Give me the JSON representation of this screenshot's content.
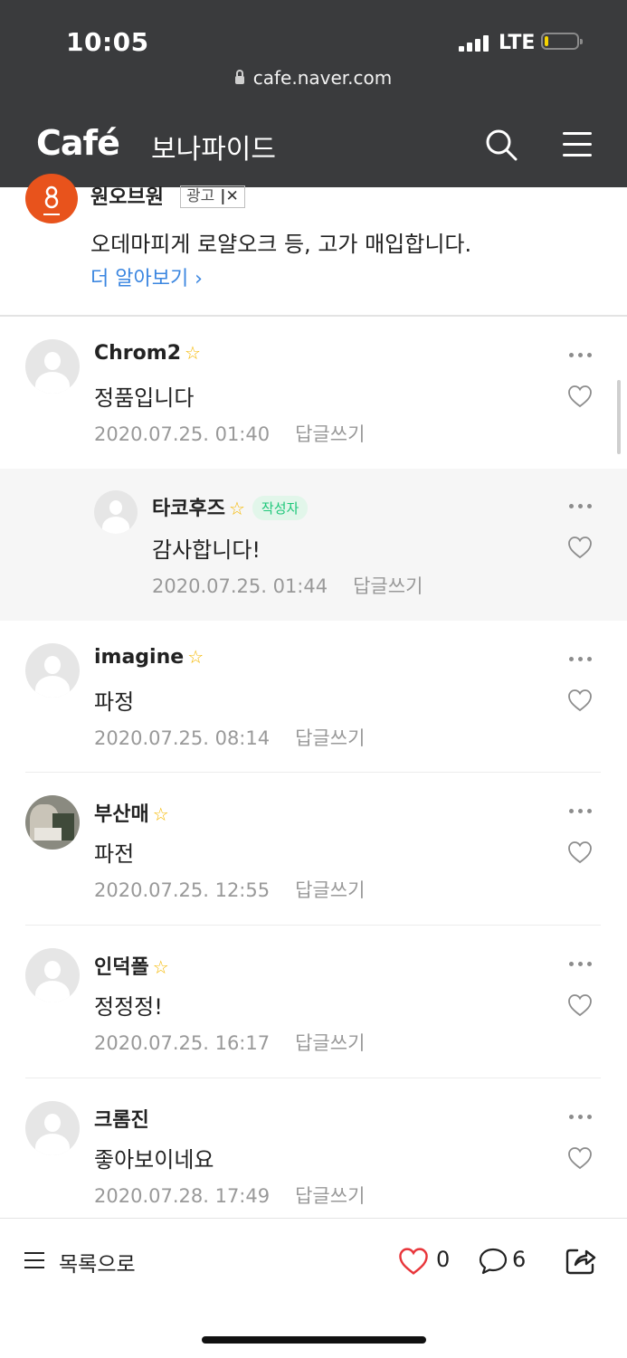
{
  "status_bar": {
    "time": "10:05",
    "network": "LTE",
    "battery_color": "#f5d300"
  },
  "browser": {
    "url": "cafe.naver.com"
  },
  "header": {
    "logo": "Café",
    "cafe_name": "보나파이드"
  },
  "ad": {
    "name": "원오브원",
    "badge": "광고",
    "text": "오데마피게 로얄오크 등, 고가 매입합니다.",
    "more": "더 알아보기 ›",
    "logo_color": "#e8531c"
  },
  "comments": [
    {
      "author": "Chrom2",
      "star": "☆",
      "text": "정품입니다",
      "date": "2020.07.25. 01:40",
      "reply": "답글쓰기"
    },
    {
      "author": "타코후즈",
      "star": "☆",
      "badge": "작성자",
      "text": "감사합니다!",
      "date": "2020.07.25. 01:44",
      "reply": "답글쓰기"
    },
    {
      "author": "imagine",
      "star": "☆",
      "text": "파정",
      "date": "2020.07.25. 08:14",
      "reply": "답글쓰기"
    },
    {
      "author": "부산매",
      "star": "☆",
      "text": "파전",
      "date": "2020.07.25. 12:55",
      "reply": "답글쓰기"
    },
    {
      "author": "인덕폴",
      "star": "☆",
      "text": "정정정!",
      "date": "2020.07.25. 16:17",
      "reply": "답글쓰기"
    },
    {
      "author": "크롬진",
      "text": "좋아보이네요",
      "date": "2020.07.28. 17:49",
      "reply": "답글쓰기"
    }
  ],
  "bottom_bar": {
    "list_label": "목록으로",
    "like_count": "0",
    "comment_count": "6"
  },
  "colors": {
    "header_bg": "#3a3b3d",
    "accent_heart": "#e8353a",
    "author_badge": "#1ec77a",
    "link": "#3b86e0"
  }
}
